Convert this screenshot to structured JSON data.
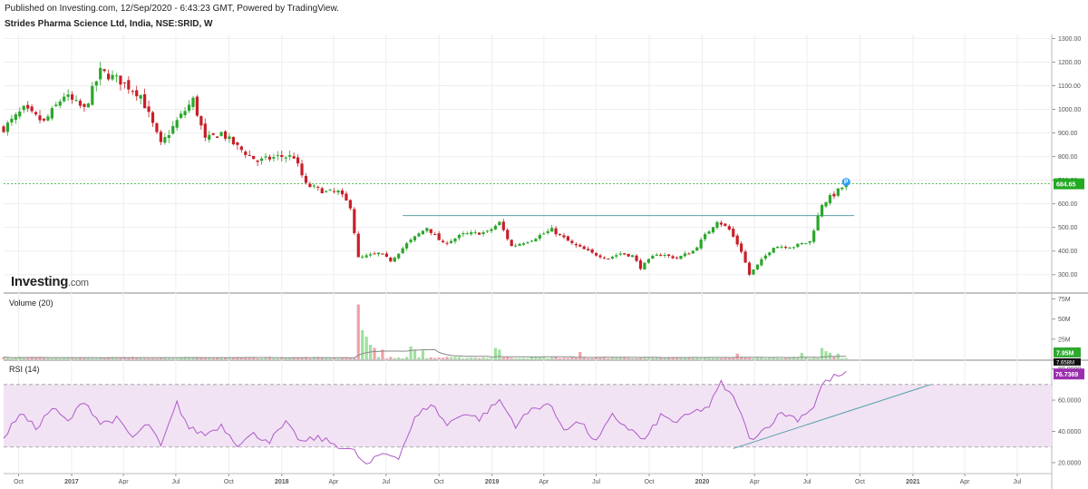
{
  "header": {
    "published": "Published on Investing.com, 12/Sep/2020 - 6:43:23 GMT, Powered by TradingView.",
    "symbol": "Strides Pharma Science Ltd, India, NSE:SRID, W"
  },
  "logo": {
    "brand": "Investing",
    "suffix": ".com"
  },
  "colors": {
    "up": "#2ba62b",
    "down": "#c81e28",
    "volume_up": "#9fe09f",
    "volume_down": "#f2a0a8",
    "rsi_line": "#b05ac8",
    "rsi_band": "#f1e3f4",
    "trendline": "#5aa0a8",
    "price_line": "#22aa22",
    "marker": "#2a9df4",
    "grid": "#eeeeee",
    "axis_text": "#555555"
  },
  "chart_data": [
    {
      "type": "candlestick",
      "title": "Strides Pharma Science Ltd, India, NSE:SRID, W",
      "timeframe": "W",
      "x_start": "2016-09-05",
      "x_end": "2021-08-30",
      "x_ticks": [
        {
          "date": "2016-10-01",
          "label": "Oct",
          "bold": false
        },
        {
          "date": "2017-01-01",
          "label": "2017",
          "bold": true
        },
        {
          "date": "2017-04-01",
          "label": "Apr",
          "bold": false
        },
        {
          "date": "2017-07-01",
          "label": "Jul",
          "bold": false
        },
        {
          "date": "2017-10-01",
          "label": "Oct",
          "bold": false
        },
        {
          "date": "2018-01-01",
          "label": "2018",
          "bold": true
        },
        {
          "date": "2018-04-01",
          "label": "Apr",
          "bold": false
        },
        {
          "date": "2018-07-01",
          "label": "Jul",
          "bold": false
        },
        {
          "date": "2018-10-01",
          "label": "Oct",
          "bold": false
        },
        {
          "date": "2019-01-01",
          "label": "2019",
          "bold": true
        },
        {
          "date": "2019-04-01",
          "label": "Apr",
          "bold": false
        },
        {
          "date": "2019-07-01",
          "label": "Jul",
          "bold": false
        },
        {
          "date": "2019-10-01",
          "label": "Oct",
          "bold": false
        },
        {
          "date": "2020-01-01",
          "label": "2020",
          "bold": true
        },
        {
          "date": "2020-04-01",
          "label": "Apr",
          "bold": false
        },
        {
          "date": "2020-07-01",
          "label": "Jul",
          "bold": false
        },
        {
          "date": "2020-10-01",
          "label": "Oct",
          "bold": false
        },
        {
          "date": "2021-01-01",
          "label": "2021",
          "bold": true
        },
        {
          "date": "2021-04-01",
          "label": "Apr",
          "bold": false
        },
        {
          "date": "2021-07-01",
          "label": "Jul",
          "bold": false
        }
      ],
      "y_range": [
        226,
        1317
      ],
      "y_ticks": [
        {
          "value": 300,
          "label": "300.00"
        },
        {
          "value": 400,
          "label": "400.00"
        },
        {
          "value": 500,
          "label": "500.00"
        },
        {
          "value": 600,
          "label": "600.00"
        },
        {
          "value": 700,
          "label": "700.00"
        },
        {
          "value": 800,
          "label": "800.00"
        },
        {
          "value": 900,
          "label": "900.00"
        },
        {
          "value": 1000,
          "label": "1000.00"
        },
        {
          "value": 1100,
          "label": "1100.00"
        },
        {
          "value": 1200,
          "label": "1200.00"
        },
        {
          "value": 1300,
          "label": "1300.00"
        }
      ],
      "last_price": 684.65,
      "last_price_label": "684.65",
      "resistance_line": {
        "x_from": "2018-07-30",
        "x_to": "2020-09-21",
        "y": 550
      },
      "marker": {
        "label": "P",
        "date": "2020-09-07"
      },
      "anchors": [
        [
          "2016-09-05",
          920
        ],
        [
          "2016-10-10",
          1000
        ],
        [
          "2016-11-14",
          945
        ],
        [
          "2016-12-19",
          1060
        ],
        [
          "2017-01-23",
          1000
        ],
        [
          "2017-02-20",
          1160
        ],
        [
          "2017-03-27",
          1120
        ],
        [
          "2017-05-01",
          1060
        ],
        [
          "2017-06-05",
          850
        ],
        [
          "2017-07-03",
          950
        ],
        [
          "2017-07-31",
          1040
        ],
        [
          "2017-08-21",
          870
        ],
        [
          "2017-09-18",
          900
        ],
        [
          "2017-10-16",
          840
        ],
        [
          "2017-11-20",
          780
        ],
        [
          "2017-12-25",
          800
        ],
        [
          "2018-01-22",
          800
        ],
        [
          "2018-02-12",
          680
        ],
        [
          "2018-03-19",
          650
        ],
        [
          "2018-04-09",
          650
        ],
        [
          "2018-04-30",
          590
        ],
        [
          "2018-05-14",
          370
        ],
        [
          "2018-06-18",
          390
        ],
        [
          "2018-07-09",
          360
        ],
        [
          "2018-08-06",
          430
        ],
        [
          "2018-09-10",
          500
        ],
        [
          "2018-10-08",
          430
        ],
        [
          "2018-11-12",
          470
        ],
        [
          "2018-12-24",
          480
        ],
        [
          "2019-01-14",
          520
        ],
        [
          "2019-02-04",
          420
        ],
        [
          "2019-03-11",
          450
        ],
        [
          "2019-04-15",
          490
        ],
        [
          "2019-05-20",
          430
        ],
        [
          "2019-06-24",
          390
        ],
        [
          "2019-07-22",
          370
        ],
        [
          "2019-08-12",
          390
        ],
        [
          "2019-09-02",
          380
        ],
        [
          "2019-09-16",
          330
        ],
        [
          "2019-10-14",
          390
        ],
        [
          "2019-11-18",
          370
        ],
        [
          "2019-12-16",
          400
        ],
        [
          "2020-01-27",
          530
        ],
        [
          "2020-02-17",
          490
        ],
        [
          "2020-03-09",
          400
        ],
        [
          "2020-03-23",
          300
        ],
        [
          "2020-04-13",
          360
        ],
        [
          "2020-05-04",
          420
        ],
        [
          "2020-06-08",
          420
        ],
        [
          "2020-07-06",
          440
        ],
        [
          "2020-07-27",
          600
        ],
        [
          "2020-08-17",
          640
        ],
        [
          "2020-09-07",
          685
        ]
      ]
    },
    {
      "type": "bar",
      "title": "Volume (20)",
      "unit": "M",
      "y_range": [
        0,
        80
      ],
      "y_ticks": [
        {
          "value": 25,
          "label": "25M"
        },
        {
          "value": 50,
          "label": "50M"
        },
        {
          "value": 75,
          "label": "75M"
        }
      ],
      "last_volume_label": "7.95M",
      "ma_label": "7.658M",
      "base_level": 2,
      "spikes": [
        [
          "2018-05-14",
          68
        ],
        [
          "2018-05-21",
          36
        ],
        [
          "2018-05-28",
          28
        ],
        [
          "2018-06-04",
          18
        ],
        [
          "2018-06-11",
          14
        ],
        [
          "2018-06-25",
          12
        ],
        [
          "2018-08-13",
          16
        ],
        [
          "2018-08-20",
          12
        ],
        [
          "2018-09-03",
          11
        ],
        [
          "2019-01-07",
          14
        ],
        [
          "2019-01-14",
          12
        ],
        [
          "2019-06-03",
          9
        ],
        [
          "2020-03-02",
          7
        ],
        [
          "2020-06-22",
          8
        ],
        [
          "2020-07-27",
          14
        ],
        [
          "2020-08-03",
          10
        ],
        [
          "2020-08-10",
          8
        ],
        [
          "2020-08-24",
          7
        ]
      ]
    },
    {
      "type": "line",
      "title": "RSI (14)",
      "y_range": [
        13,
        85
      ],
      "y_ticks": [
        {
          "value": 20,
          "label": "20.0000"
        },
        {
          "value": 40,
          "label": "40.0000"
        },
        {
          "value": 60,
          "label": "60.0000"
        },
        {
          "value": 80,
          "label": "80.0000"
        }
      ],
      "band": [
        30,
        70
      ],
      "last_value": 76.7369,
      "last_value_label": "76.7369",
      "trendline": {
        "from": [
          "2020-02-24",
          29
        ],
        "to": [
          "2021-02-01",
          70
        ]
      },
      "anchors": [
        [
          "2016-09-05",
          35
        ],
        [
          "2016-10-03",
          52
        ],
        [
          "2016-10-31",
          42
        ],
        [
          "2016-11-28",
          55
        ],
        [
          "2016-12-26",
          46
        ],
        [
          "2017-01-23",
          60
        ],
        [
          "2017-02-20",
          45
        ],
        [
          "2017-03-20",
          48
        ],
        [
          "2017-04-17",
          36
        ],
        [
          "2017-05-15",
          45
        ],
        [
          "2017-06-05",
          30
        ],
        [
          "2017-07-03",
          58
        ],
        [
          "2017-07-24",
          42
        ],
        [
          "2017-08-21",
          38
        ],
        [
          "2017-09-18",
          44
        ],
        [
          "2017-10-16",
          32
        ],
        [
          "2017-11-13",
          38
        ],
        [
          "2017-12-11",
          34
        ],
        [
          "2018-01-08",
          45
        ],
        [
          "2018-02-05",
          33
        ],
        [
          "2018-03-05",
          36
        ],
        [
          "2018-04-02",
          32
        ],
        [
          "2018-05-07",
          27
        ],
        [
          "2018-05-28",
          18
        ],
        [
          "2018-06-25",
          26
        ],
        [
          "2018-07-23",
          24
        ],
        [
          "2018-08-20",
          48
        ],
        [
          "2018-09-17",
          58
        ],
        [
          "2018-10-15",
          44
        ],
        [
          "2018-11-12",
          52
        ],
        [
          "2018-12-10",
          48
        ],
        [
          "2019-01-14",
          60
        ],
        [
          "2019-02-11",
          44
        ],
        [
          "2019-03-11",
          54
        ],
        [
          "2019-04-08",
          58
        ],
        [
          "2019-05-06",
          42
        ],
        [
          "2019-06-03",
          46
        ],
        [
          "2019-07-01",
          33
        ],
        [
          "2019-07-29",
          50
        ],
        [
          "2019-08-26",
          42
        ],
        [
          "2019-09-23",
          34
        ],
        [
          "2019-10-21",
          50
        ],
        [
          "2019-11-18",
          46
        ],
        [
          "2019-12-16",
          52
        ],
        [
          "2020-01-13",
          56
        ],
        [
          "2020-02-03",
          71
        ],
        [
          "2020-03-02",
          58
        ],
        [
          "2020-03-23",
          35
        ],
        [
          "2020-04-20",
          42
        ],
        [
          "2020-05-18",
          52
        ],
        [
          "2020-06-15",
          48
        ],
        [
          "2020-07-13",
          56
        ],
        [
          "2020-07-27",
          70
        ],
        [
          "2020-08-17",
          75
        ],
        [
          "2020-09-07",
          76.7
        ]
      ]
    }
  ]
}
